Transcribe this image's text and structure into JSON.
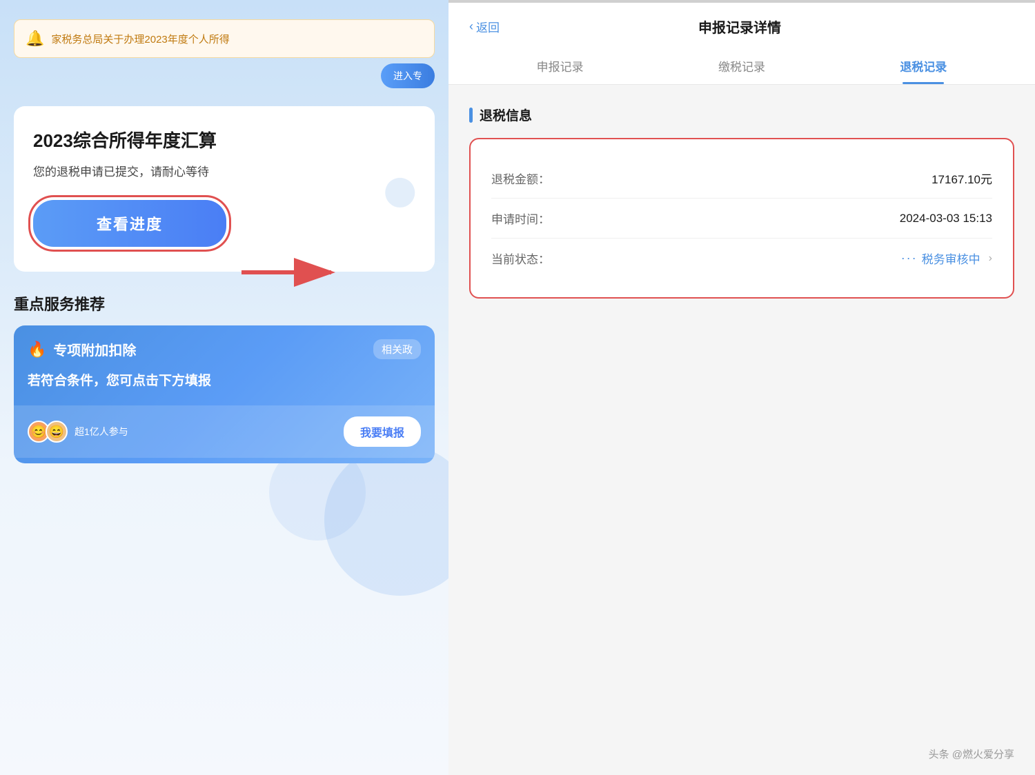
{
  "left": {
    "notification": {
      "icon": "🔔",
      "text": "家税务总局关于办理2023年度个人所得"
    },
    "enter_button": "进入专",
    "main_card": {
      "title": "2023综合所得年度汇算",
      "subtitle": "您的退税申请已提交，请耐心等待",
      "button_label": "查看进度"
    },
    "section_title": "重点服务推荐",
    "service_card": {
      "icon": "🔥",
      "title": "专项附加扣除",
      "policy_link": "相关政",
      "description": "若符合条件，您可点击下方填报",
      "participant_count": "超1亿人参与",
      "fill_btn_label": "我要填报"
    }
  },
  "right": {
    "header": {
      "back_label": "返回",
      "page_title": "申报记录详情"
    },
    "tabs": [
      {
        "label": "申报记录",
        "active": false
      },
      {
        "label": "缴税记录",
        "active": false
      },
      {
        "label": "退税记录",
        "active": true
      }
    ],
    "section_label": "退税信息",
    "info_rows": [
      {
        "label": "退税金额：",
        "value": "17167.10元"
      },
      {
        "label": "申请时间：",
        "value": "2024-03-03 15:13"
      },
      {
        "label": "当前状态：",
        "value": "税务审核中",
        "is_status": true
      }
    ],
    "watermark": "头条 @燃火爱分享"
  },
  "arrow": {
    "color": "#e05050"
  }
}
